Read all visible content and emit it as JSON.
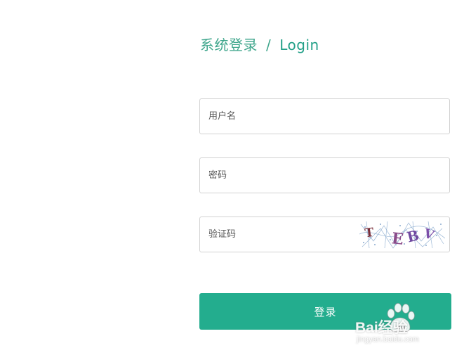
{
  "header": {
    "title_cn": "系统登录",
    "separator": "/",
    "title_en": "Login"
  },
  "form": {
    "username": {
      "placeholder": "用户名",
      "value": ""
    },
    "password": {
      "placeholder": "密码",
      "value": ""
    },
    "captcha": {
      "placeholder": "验证码",
      "value": "",
      "image_text": "T EBV"
    },
    "submit_label": "登录"
  },
  "watermark": {
    "brand": "Bai经验",
    "url": "jingyan.baidu.com"
  },
  "colors": {
    "accent": "#23ad8e",
    "title": "#3fa68c",
    "border": "#d2d2d2",
    "background": "#ffffff"
  },
  "icons": {
    "captcha_image": "captcha-image",
    "watermark_logo": "paw-icon"
  }
}
